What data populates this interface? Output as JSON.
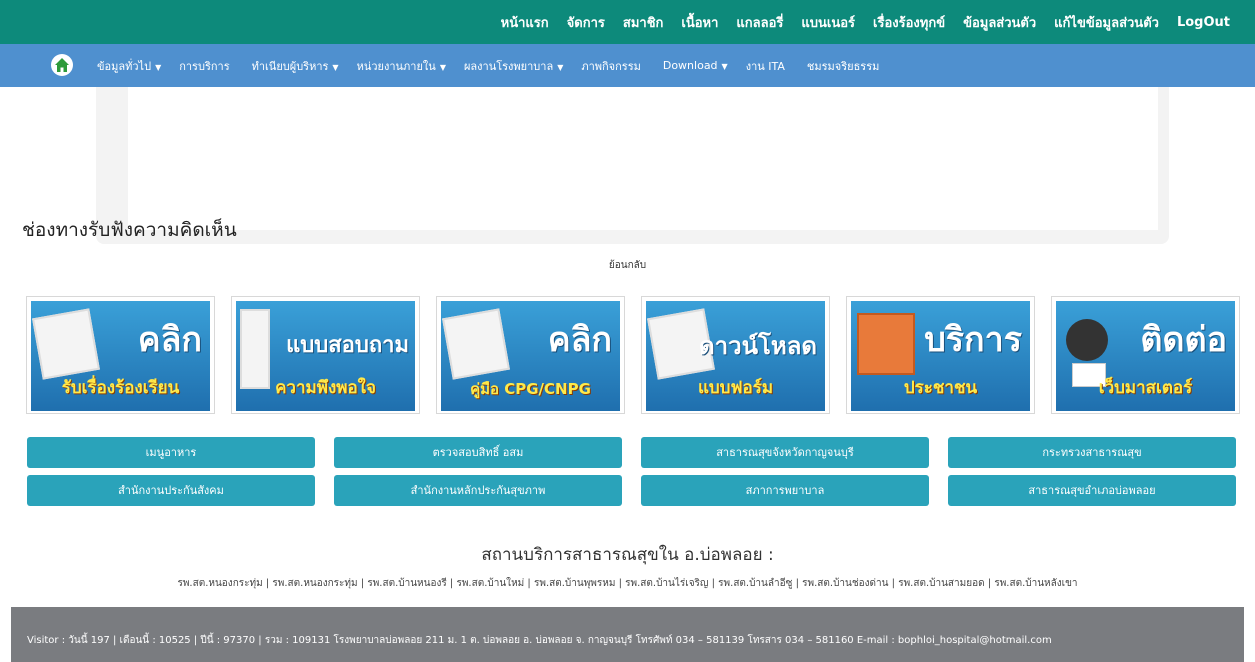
{
  "topbar": {
    "items": [
      "หน้าแรก",
      "จัดการ",
      "สมาชิก",
      "เนื้อหา",
      "แกลลอรี่",
      "แบนเนอร์",
      "เรื่องร้องทุกข์",
      "ข้อมูลส่วนตัว",
      "แก้ไขข้อมูลส่วนตัว",
      "LogOut"
    ]
  },
  "navbar": {
    "items": [
      {
        "label": "ข้อมูลทั่วไป",
        "caret": "▼"
      },
      {
        "label": "การบริการ",
        "caret": ""
      },
      {
        "label": "ทำเนียบผู้บริหาร",
        "caret": "▼"
      },
      {
        "label": "หน่วยงานภายใน",
        "caret": "▼"
      },
      {
        "label": "ผลงานโรงพยาบาล",
        "caret": "▼"
      },
      {
        "label": "ภาพกิจกรรม",
        "caret": ""
      },
      {
        "label": "Download",
        "caret": "▼"
      },
      {
        "label": "งาน ITA",
        "caret": ""
      },
      {
        "label": "ชมรมจริยธรรม",
        "caret": ""
      }
    ]
  },
  "section": {
    "heading": "ช่องทางรับฟังความคิดเห็น",
    "back": "ย้อนกลับ"
  },
  "banners": [
    {
      "title": "คลิก",
      "sub": "รับเรื่องร้องเรียน",
      "icon": "document-pen-icon"
    },
    {
      "title": "แบบสอบถาม",
      "sub": "ความพึงพอใจ",
      "icon": "survey-sheet-icon"
    },
    {
      "title": "คลิก",
      "sub": "คู่มือ CPG/CNPG",
      "icon": "manual-book-icon"
    },
    {
      "title": "ดาวน์โหลด",
      "sub": "แบบฟอร์ม",
      "icon": "form-icon"
    },
    {
      "title": "บริการ",
      "sub": "ประชาชน",
      "icon": "service-person-icon"
    },
    {
      "title": "ติดต่อ",
      "sub": "เว็บมาสเตอร์",
      "icon": "webmaster-icon"
    }
  ],
  "links": [
    "เมนูอาหาร",
    "ตรวจสอบสิทธิ์ อสม",
    "สาธารณสุขจังหวัดกาญจนบุรี",
    "กระทรวงสาธารณสุข",
    "สำนักงานประกันสังคม",
    "สำนักงานหลักประกันสุขภาพ",
    "สภาการพยาบาล",
    "สาธารณสุขอำเภอบ่อพลอย"
  ],
  "services": {
    "title": "สถานบริการสาธารณสุขใน อ.บ่อพลอย :",
    "list": "รพ.สต.หนองกระทุ่ม | รพ.สต.หนองกระทุ่ม | รพ.สต.บ้านหนองรี | รพ.สต.บ้านใหม่ | รพ.สต.บ้านพุพรหม | รพ.สต.บ้านไร่เจริญ | รพ.สต.บ้านลำอีซู | รพ.สต.บ้านช่องด่าน | รพ.สต.บ้านสามยอด | รพ.สต.บ้านหลังเขา"
  },
  "footer": {
    "text": "Visitor : วันนี้ 197 | เดือนนี้ : 10525 | ปีนี้ : 97370 | รวม : 109131 โรงพยาบาลบ่อพลอย 211 ม. 1 ต. บ่อพลอย อ. บ่อพลอย จ. กาญจนบุรี โทรศัพท์ 034 – 581139 โทรสาร 034 – 581160 E-mail : bophloi_hospital@hotmail.com"
  }
}
